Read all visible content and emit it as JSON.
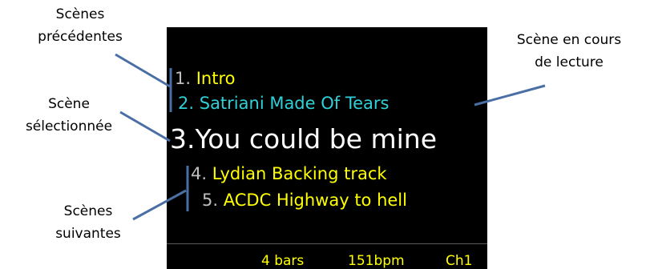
{
  "annotations": {
    "previous": [
      "Scènes",
      "précédentes"
    ],
    "selected": [
      "Scène",
      "sélectionnée"
    ],
    "next": [
      "Scènes",
      "suivantes"
    ],
    "playing": [
      "Scène en cours",
      "de lecture"
    ]
  },
  "scenes": [
    {
      "number": "1.",
      "name": "Intro"
    },
    {
      "number": "2.",
      "name": "Satriani Made Of Tears"
    },
    {
      "number": "3.",
      "name": "You could be mine"
    },
    {
      "number": "4.",
      "name": "Lydian Backing track"
    },
    {
      "number": "5.",
      "name": "ACDC Highway to hell"
    }
  ],
  "status": {
    "bars": "4 bars",
    "tempo": "151bpm",
    "channel": "Ch1"
  },
  "colors": {
    "screen_bg": "#000000",
    "scene_default": "#ffff00",
    "scene_playing": "#2fd0d8",
    "scene_selected": "#ffffff",
    "annotation_line": "#4a6fa5"
  }
}
